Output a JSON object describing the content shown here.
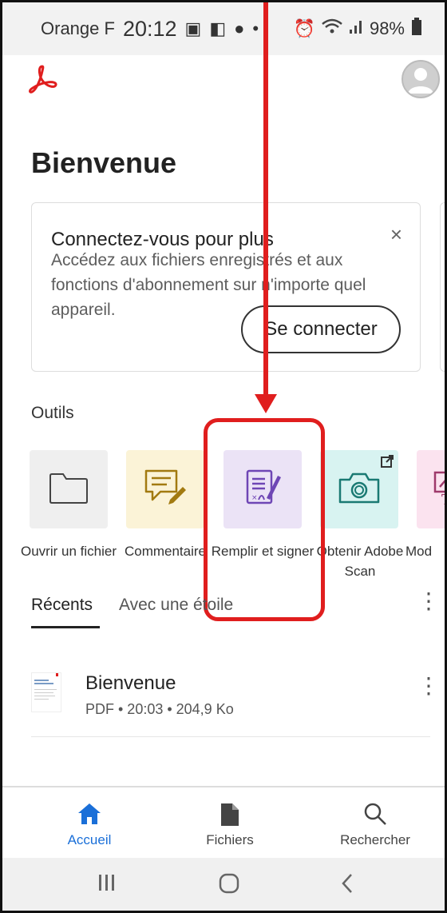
{
  "status_bar": {
    "carrier": "Orange F",
    "time": "20:12",
    "battery": "98%"
  },
  "page": {
    "title": "Bienvenue"
  },
  "signin_card": {
    "title": "Connectez-vous pour plus",
    "body": "Accédez aux fichiers enregistrés et aux fonctions d'abonnement sur n'importe quel appareil.",
    "close": "×",
    "button": "Se connecter"
  },
  "tools": {
    "heading": "Outils",
    "items": [
      {
        "label": "Ouvrir un fichier",
        "icon": "folder-icon",
        "bg": "#efefef"
      },
      {
        "label": "Commentaire",
        "icon": "comment-icon",
        "bg": "#fbf3d7"
      },
      {
        "label": "Remplir et signer",
        "icon": "fill-sign-icon",
        "bg": "#ebe3f6"
      },
      {
        "label": "Obtenir Adobe Scan",
        "icon": "camera-icon",
        "bg": "#d8f3f1"
      },
      {
        "label": "Mod",
        "icon": "edit-text-icon",
        "bg": "#fbe3ef"
      }
    ]
  },
  "tabs": {
    "recent": "Récents",
    "starred": "Avec une étoile"
  },
  "recent_files": [
    {
      "name": "Bienvenue",
      "meta": "PDF • 20:03 • 204,9 Ko"
    }
  ],
  "bottom_nav": {
    "home": "Accueil",
    "files": "Fichiers",
    "search": "Rechercher"
  },
  "colors": {
    "accent": "#1a6fd8",
    "annotation": "#e01e1e",
    "adobe_red": "#e01e1e"
  }
}
